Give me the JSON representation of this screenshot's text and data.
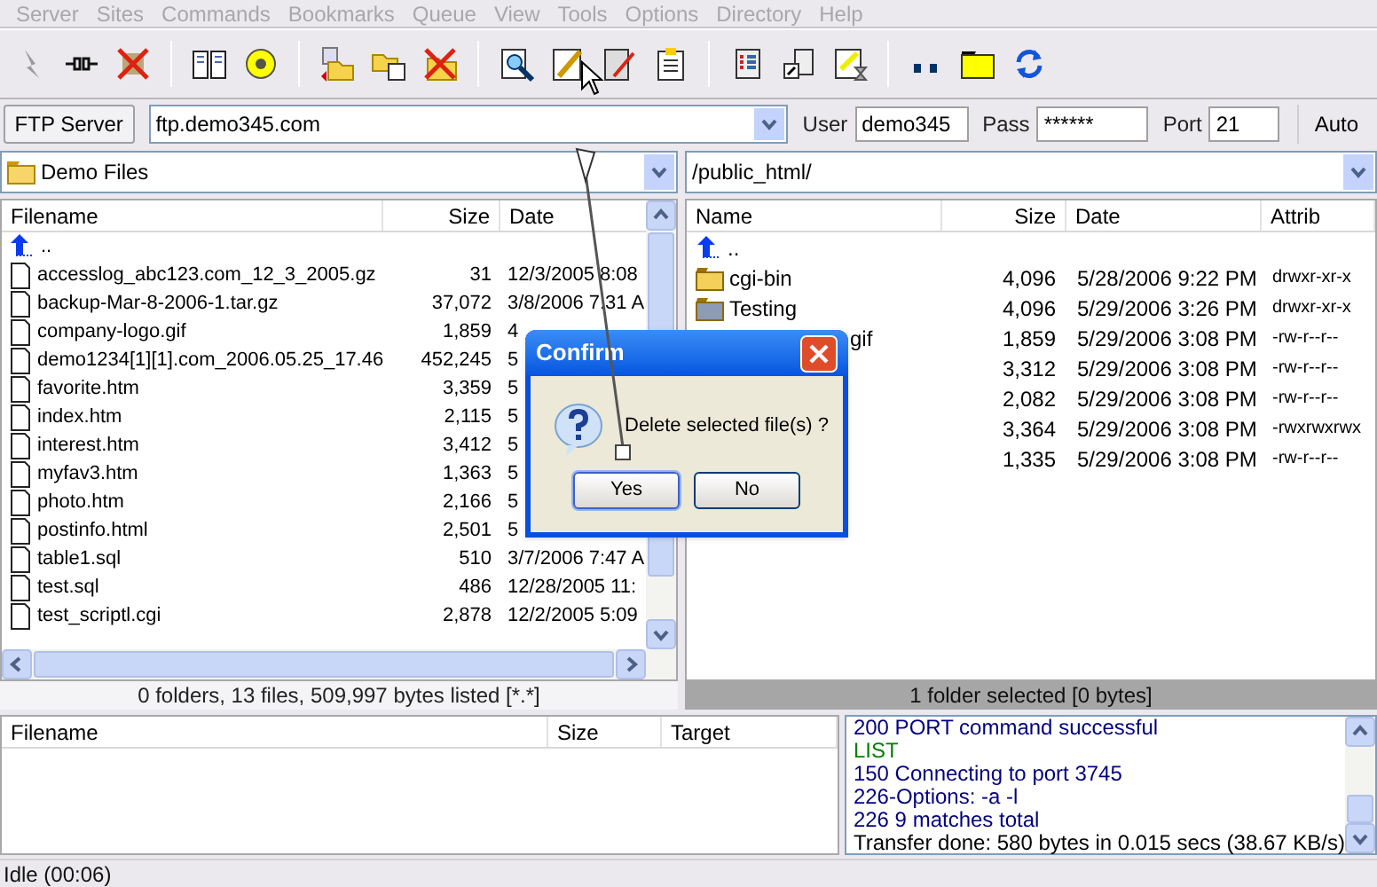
{
  "menu": [
    "Server",
    "Sites",
    "Commands",
    "Bookmarks",
    "Queue",
    "View",
    "Tools",
    "Options",
    "Directory",
    "Help"
  ],
  "connection": {
    "server_button": "FTP Server",
    "host": "ftp.demo345.com",
    "user_label": "User",
    "user": "demo345",
    "pass_label": "Pass",
    "password": "******",
    "port_label": "Port",
    "port": "21",
    "auto_button": "Auto"
  },
  "local": {
    "path": "Demo Files",
    "columns": [
      "Filename",
      "Size",
      "Date"
    ],
    "rows": [
      {
        "kind": "up",
        "name": ".."
      },
      {
        "kind": "file",
        "name": "accesslog_abc123.com_12_3_2005.gz",
        "size": "31",
        "date": "12/3/2005 8:08"
      },
      {
        "kind": "file",
        "name": "backup-Mar-8-2006-1.tar.gz",
        "size": "37,072",
        "date": "3/8/2006 7:31 A"
      },
      {
        "kind": "file",
        "name": "company-logo.gif",
        "size": "1,859",
        "date": "4"
      },
      {
        "kind": "file",
        "name": "demo1234[1][1].com_2006.05.25_17.46",
        "size": "452,245",
        "date": "5"
      },
      {
        "kind": "file",
        "name": "favorite.htm",
        "size": "3,359",
        "date": "5"
      },
      {
        "kind": "file",
        "name": "index.htm",
        "size": "2,115",
        "date": "5"
      },
      {
        "kind": "file",
        "name": "interest.htm",
        "size": "3,412",
        "date": "5"
      },
      {
        "kind": "file",
        "name": "myfav3.htm",
        "size": "1,363",
        "date": "5"
      },
      {
        "kind": "file",
        "name": "photo.htm",
        "size": "2,166",
        "date": "5"
      },
      {
        "kind": "file",
        "name": "postinfo.html",
        "size": "2,501",
        "date": "5"
      },
      {
        "kind": "file",
        "name": "table1.sql",
        "size": "510",
        "date": "3/7/2006 7:47 A"
      },
      {
        "kind": "file",
        "name": "test.sql",
        "size": "486",
        "date": "12/28/2005 11:"
      },
      {
        "kind": "file",
        "name": "test_scriptl.cgi",
        "size": "2,878",
        "date": "12/2/2005 5:09"
      }
    ],
    "status": "0 folders, 13 files, 509,997 bytes listed [*.*]"
  },
  "remote": {
    "path": "/public_html/",
    "columns": [
      "Name",
      "Size",
      "Date",
      "Attrib"
    ],
    "rows": [
      {
        "kind": "up",
        "name": ".."
      },
      {
        "kind": "folder",
        "name": "cgi-bin",
        "size": "4,096",
        "date": "5/28/2006 9:22 PM",
        "attrib": "drwxr-xr-x",
        "selected": false
      },
      {
        "kind": "folder",
        "name": "Testing",
        "size": "4,096",
        "date": "5/29/2006 3:26 PM",
        "attrib": "drwxr-xr-x",
        "selected": true
      },
      {
        "name": "gif",
        "cut": true,
        "size": "1,859",
        "date": "5/29/2006 3:08 PM",
        "attrib": "-rw-r--r--"
      },
      {
        "size": "3,312",
        "date": "5/29/2006 3:08 PM",
        "attrib": "-rw-r--r--"
      },
      {
        "size": "2,082",
        "date": "5/29/2006 3:08 PM",
        "attrib": "-rw-r--r--"
      },
      {
        "size": "3,364",
        "date": "5/29/2006 3:08 PM",
        "attrib": "-rwxrwxrwx"
      },
      {
        "size": "1,335",
        "date": "5/29/2006 3:08 PM",
        "attrib": "-rw-r--r--"
      }
    ],
    "status": "1 folder selected [0 bytes]"
  },
  "queue": {
    "columns": [
      "Filename",
      "Size",
      "Target"
    ]
  },
  "log": [
    {
      "kind": "reply",
      "text": "200 PORT command successful"
    },
    {
      "kind": "command",
      "text": "LIST"
    },
    {
      "kind": "reply",
      "text": "150 Connecting to port 3745"
    },
    {
      "kind": "reply",
      "text": "226-Options: -a -l"
    },
    {
      "kind": "reply",
      "text": "226 9 matches total"
    },
    {
      "kind": "status",
      "text": "Transfer done: 580 bytes in 0.015 secs (38.67 KB/s)"
    }
  ],
  "dialog": {
    "title": "Confirm",
    "message": "Delete selected file(s) ?",
    "buttons": [
      {
        "label": "Yes",
        "focused": true
      },
      {
        "label": "No",
        "focused": false
      }
    ]
  },
  "status_bar": "Idle (00:06)"
}
